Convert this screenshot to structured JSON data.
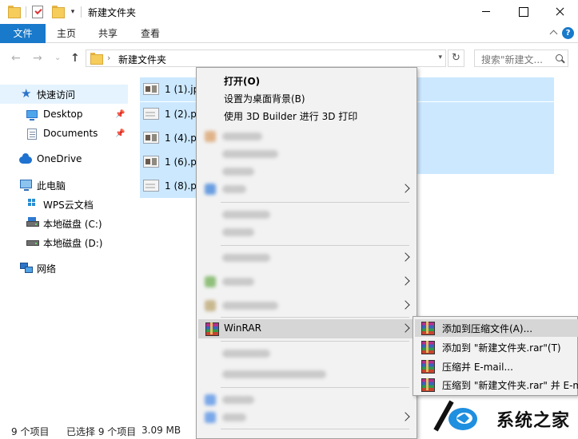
{
  "window": {
    "title": "新建文件夹",
    "minimize": "—",
    "maximize": "□",
    "close": "✕"
  },
  "ribbon": {
    "tabs": [
      "文件",
      "主页",
      "共享",
      "查看"
    ],
    "help": "?"
  },
  "navigation": {
    "back": "←",
    "forward": "→",
    "recent": "⌄",
    "up": "↑",
    "address": "新建文件夹",
    "refresh": "↻",
    "search_placeholder": "搜索\"新建文..."
  },
  "nav_pane": {
    "items": [
      {
        "label": "快速访问",
        "icon": "star-icon",
        "selected": true
      },
      {
        "label": "Desktop",
        "icon": "desktop-icon",
        "pinned": true
      },
      {
        "label": "Documents",
        "icon": "documents-icon",
        "pinned": true
      },
      {
        "label": "OneDrive",
        "icon": "onedrive-icon"
      },
      {
        "label": "此电脑",
        "icon": "pc-icon"
      },
      {
        "label": "WPS云文档",
        "icon": "wps-icon"
      },
      {
        "label": "本地磁盘 (C:)",
        "icon": "disk-c-icon"
      },
      {
        "label": "本地磁盘 (D:)",
        "icon": "disk-d-icon"
      },
      {
        "label": "网络",
        "icon": "network-icon"
      }
    ]
  },
  "files": [
    {
      "name": "1 (1).jpg"
    },
    {
      "name": "1 (2).p"
    },
    {
      "name": "1 (4).p"
    },
    {
      "name": "1 (6).p"
    },
    {
      "name": "1 (8).p"
    }
  ],
  "status": {
    "count": "9 个项目",
    "selected": "已选择 9 个项目",
    "size": "3.09 MB"
  },
  "context_menu": {
    "open": "打开(O)",
    "set_wallpaper": "设置为桌面背景(B)",
    "print_3d": "使用 3D Builder 进行 3D 打印",
    "winrar": "WinRAR"
  },
  "winrar_submenu": {
    "items": [
      "添加到压缩文件(A)...",
      "添加到 \"新建文件夹.rar\"(T)",
      "压缩并 E-mail...",
      "压缩到 \"新建文件夹.rar\" 并 E-m"
    ]
  },
  "watermark": {
    "text": "系统之家"
  },
  "colors": {
    "accent": "#1979ca",
    "selection": "#cce8ff",
    "menu_bg": "#f2f2f2",
    "menu_highlight": "#d6d6d6"
  }
}
